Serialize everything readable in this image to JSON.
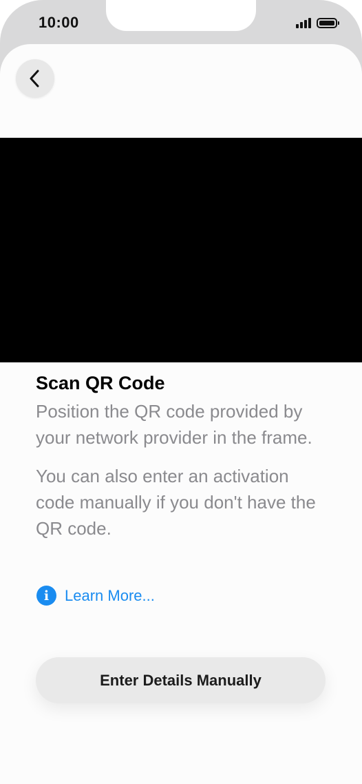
{
  "status_bar": {
    "time": "10:00",
    "icons": [
      "cellular-signal-icon",
      "battery-icon"
    ]
  },
  "nav": {
    "back_icon": "chevron-left-icon"
  },
  "scan": {
    "title": "Scan QR Code",
    "description": "Position the QR code provided by your network provider in the frame.",
    "manual_hint": "You can also enter an activation code manually if you don't have the QR code.",
    "learn_more_icon": "info-icon",
    "learn_more_label": "Learn More...",
    "manual_button_label": "Enter Details Manually"
  },
  "colors": {
    "accent": "#1a8cf0",
    "camera_view": "#000000",
    "secondary_text": "#8a8a8e",
    "bezel": "#d9d9da"
  }
}
